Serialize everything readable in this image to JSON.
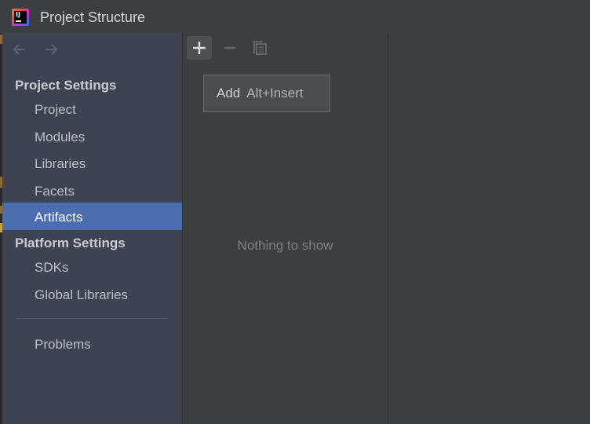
{
  "window": {
    "title": "Project Structure",
    "icon": "intellij-app-icon",
    "icon_letters": "IJ"
  },
  "navigation": {
    "back_icon": "arrow-left-icon",
    "forward_icon": "arrow-right-icon"
  },
  "sidebar": {
    "project_settings_header": "Project Settings",
    "project_settings_items": [
      {
        "label": "Project",
        "selected": false
      },
      {
        "label": "Modules",
        "selected": false
      },
      {
        "label": "Libraries",
        "selected": false
      },
      {
        "label": "Facets",
        "selected": false
      },
      {
        "label": "Artifacts",
        "selected": true
      }
    ],
    "platform_settings_header": "Platform Settings",
    "platform_settings_items": [
      {
        "label": "SDKs",
        "selected": false
      },
      {
        "label": "Global Libraries",
        "selected": false
      }
    ],
    "problems_label": "Problems"
  },
  "toolbar": {
    "add_icon": "plus-icon",
    "remove_icon": "minus-icon",
    "copy_icon": "copy-icon"
  },
  "tooltip": {
    "action": "Add",
    "shortcut": "Alt+Insert"
  },
  "content": {
    "empty_text": "Nothing to show"
  },
  "colors": {
    "background": "#3c3f41",
    "sidebar": "#3d4350",
    "selection": "#4b6eaf",
    "text": "#bcbfc4",
    "header_text": "#c8cbd0",
    "muted_text": "#7e8184"
  }
}
